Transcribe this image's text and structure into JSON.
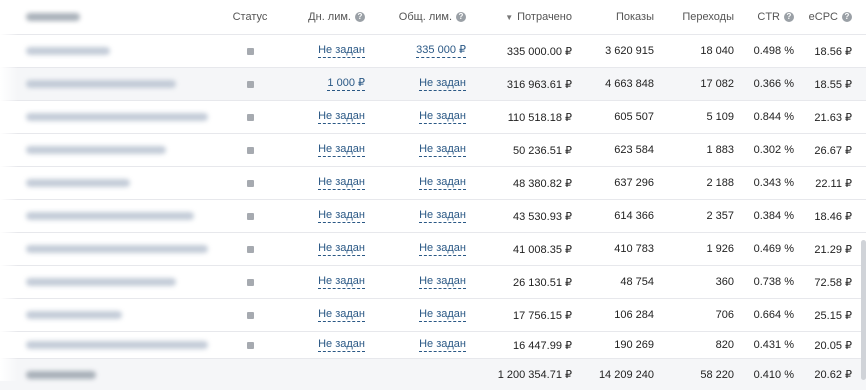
{
  "header": {
    "name": "",
    "status": "Статус",
    "daily_limit": "Дн. лим.",
    "total_limit": "Общ. лим.",
    "spent": "Потрачено",
    "shows": "Показы",
    "clicks": "Переходы",
    "ctr": "CTR",
    "ecpc": "eCPC"
  },
  "icons": {
    "help": "?",
    "sort_down": "▼"
  },
  "rows": [
    {
      "daily": "Не задан",
      "total": "335 000 ₽",
      "spent": "335 000.00 ₽",
      "shows": "3 620 915",
      "clicks": "18 040",
      "ctr": "0.498 %",
      "ecpc": "18.56 ₽"
    },
    {
      "daily": "1 000 ₽",
      "total": "Не задан",
      "spent": "316 963.61 ₽",
      "shows": "4 663 848",
      "clicks": "17 082",
      "ctr": "0.366 %",
      "ecpc": "18.55 ₽"
    },
    {
      "daily": "Не задан",
      "total": "Не задан",
      "spent": "110 518.18 ₽",
      "shows": "605 507",
      "clicks": "5 109",
      "ctr": "0.844 %",
      "ecpc": "21.63 ₽"
    },
    {
      "daily": "Не задан",
      "total": "Не задан",
      "spent": "50 236.51 ₽",
      "shows": "623 584",
      "clicks": "1 883",
      "ctr": "0.302 %",
      "ecpc": "26.67 ₽"
    },
    {
      "daily": "Не задан",
      "total": "Не задан",
      "spent": "48 380.82 ₽",
      "shows": "637 296",
      "clicks": "2 188",
      "ctr": "0.343 %",
      "ecpc": "22.11 ₽"
    },
    {
      "daily": "Не задан",
      "total": "Не задан",
      "spent": "43 530.93 ₽",
      "shows": "614 366",
      "clicks": "2 357",
      "ctr": "0.384 %",
      "ecpc": "18.46 ₽"
    },
    {
      "daily": "Не задан",
      "total": "Не задан",
      "spent": "41 008.35 ₽",
      "shows": "410 783",
      "clicks": "1 926",
      "ctr": "0.469 %",
      "ecpc": "21.29 ₽"
    },
    {
      "daily": "Не задан",
      "total": "Не задан",
      "spent": "26 130.51 ₽",
      "shows": "48 754",
      "clicks": "360",
      "ctr": "0.738 %",
      "ecpc": "72.58 ₽"
    },
    {
      "daily": "Не задан",
      "total": "Не задан",
      "spent": "17 756.15 ₽",
      "shows": "106 284",
      "clicks": "706",
      "ctr": "0.664 %",
      "ecpc": "25.15 ₽"
    },
    {
      "daily": "Не задан",
      "total": "Не задан",
      "spent": "16 447.99 ₽",
      "shows": "190 269",
      "clicks": "820",
      "ctr": "0.431 %",
      "ecpc": "20.05 ₽"
    }
  ],
  "totals": {
    "spent": "1 200 354.71 ₽",
    "shows": "14 209 240",
    "clicks": "58 220",
    "ctr": "0.410 %",
    "ecpc": "20.62 ₽"
  },
  "colors": {
    "link": "#2a5885",
    "highlight_row": "#f5f6f8"
  }
}
